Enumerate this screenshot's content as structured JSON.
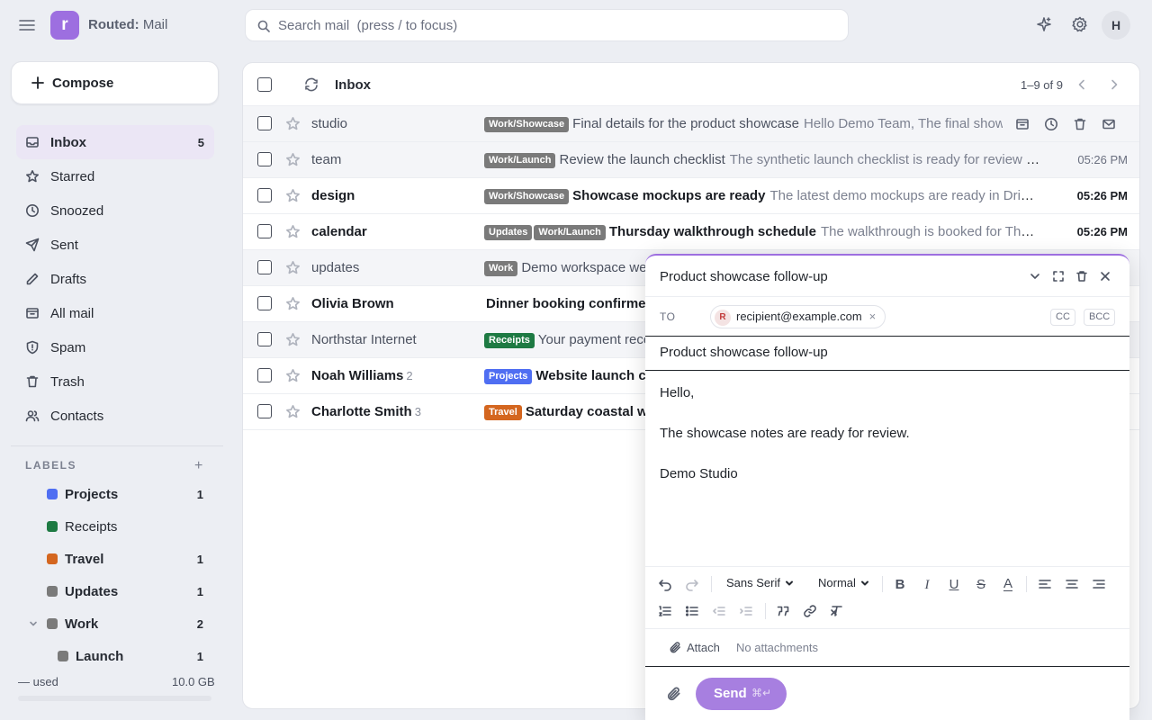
{
  "app": {
    "name_bold": "Routed:",
    "name_rest": " Mail",
    "logo_letter": "r",
    "brand_color": "#9d6fe0"
  },
  "search": {
    "placeholder": "Search mail  (press / to focus)"
  },
  "user": {
    "initial": "H"
  },
  "compose_label": "Compose",
  "nav": [
    {
      "label": "Inbox",
      "count": "5",
      "icon": "inbox-icon"
    },
    {
      "label": "Starred",
      "count": "",
      "icon": "star-icon"
    },
    {
      "label": "Snoozed",
      "count": "",
      "icon": "clock-icon"
    },
    {
      "label": "Sent",
      "count": "",
      "icon": "send-icon"
    },
    {
      "label": "Drafts",
      "count": "",
      "icon": "pencil-icon"
    },
    {
      "label": "All mail",
      "count": "",
      "icon": "archive-icon"
    },
    {
      "label": "Spam",
      "count": "",
      "icon": "shield-icon"
    },
    {
      "label": "Trash",
      "count": "",
      "icon": "trash-icon"
    },
    {
      "label": "Contacts",
      "count": "",
      "icon": "users-icon"
    }
  ],
  "labels_header": "LABELS",
  "labels_add": "+",
  "labels": [
    {
      "name": "Projects",
      "count": "1",
      "color": "#4f6ef2"
    },
    {
      "name": "Receipts",
      "count": "",
      "color": "#1e7a43"
    },
    {
      "name": "Travel",
      "count": "1",
      "color": "#d4661f"
    },
    {
      "name": "Updates",
      "count": "1",
      "color": "#7a7a7a"
    },
    {
      "name": "Work",
      "count": "2",
      "color": "#7a7a7a"
    },
    {
      "name": "Launch",
      "count": "1",
      "color": "#7a7a7a"
    }
  ],
  "storage": {
    "used": "— used",
    "total": "10.0 GB"
  },
  "mailbox": {
    "title": "Inbox",
    "range": "1–9 of 9"
  },
  "messages": [
    {
      "sender": "studio",
      "count": "",
      "unread": false,
      "tags": [
        [
          "Work/Showcase",
          "#7a7a7a"
        ]
      ],
      "subject": "Final details for the product showcase",
      "snippet": "Hello Demo Team, The final showcase details are ready",
      "time": "",
      "hovered": true
    },
    {
      "sender": "team",
      "count": "",
      "unread": false,
      "tags": [
        [
          "Work/Launch",
          "#7a7a7a"
        ]
      ],
      "subject": "Review the launch checklist",
      "snippet": "The synthetic launch checklist is ready for review be...",
      "time": "05:26 PM"
    },
    {
      "sender": "design",
      "count": "",
      "unread": true,
      "tags": [
        [
          "Work/Showcase",
          "#7a7a7a"
        ]
      ],
      "subject": "Showcase mockups are ready",
      "snippet": "The latest demo mockups are ready in Drive u...",
      "time": "05:26 PM"
    },
    {
      "sender": "calendar",
      "count": "",
      "unread": true,
      "tags": [
        [
          "Updates",
          "#7a7a7a"
        ],
        [
          "Work/Launch",
          "#7a7a7a"
        ]
      ],
      "subject": "Thursday walkthrough schedule",
      "snippet": "The walkthrough is booked for Thurs...",
      "time": "05:26 PM"
    },
    {
      "sender": "updates",
      "count": "",
      "unread": false,
      "tags": [
        [
          "Work",
          "#7a7a7a"
        ]
      ],
      "subject": "Demo workspace wee",
      "snippet": "",
      "time": ""
    },
    {
      "sender": "Olivia Brown",
      "count": "",
      "unread": true,
      "tags": [],
      "subject": "Dinner booking confirmed",
      "snippet": "",
      "time": ""
    },
    {
      "sender": "Northstar Internet",
      "count": "",
      "unread": false,
      "tags": [
        [
          "Receipts",
          "#1e7a43"
        ]
      ],
      "subject": "Your payment rece",
      "snippet": "",
      "time": ""
    },
    {
      "sender": "Noah Williams",
      "count": "2",
      "unread": true,
      "tags": [
        [
          "Projects",
          "#4f6ef2"
        ]
      ],
      "subject": "Website launch ch",
      "snippet": "",
      "time": ""
    },
    {
      "sender": "Charlotte Smith",
      "count": "3",
      "unread": true,
      "tags": [
        [
          "Travel",
          "#d4661f"
        ]
      ],
      "subject": "Saturday coastal wa",
      "snippet": "",
      "time": ""
    }
  ],
  "compose": {
    "title": "Product showcase follow-up",
    "to_label": "TO",
    "recipient": "recipient@example.com",
    "recipient_initial": "R",
    "chip_remove": "×",
    "cc": "CC",
    "bcc": "BCC",
    "subject": "Product showcase follow-up",
    "body": [
      "Hello,",
      "",
      "The showcase notes are ready for review.",
      "",
      "Demo Studio"
    ],
    "font": "Sans Serif",
    "size": "Normal",
    "bold": "B",
    "italic": "I",
    "underline": "U",
    "strike": "S",
    "color_btn": "A",
    "attach_label": "Attach",
    "no_attachments": "No attachments",
    "send_label": "Send",
    "send_shortcut": "⌘↵"
  }
}
